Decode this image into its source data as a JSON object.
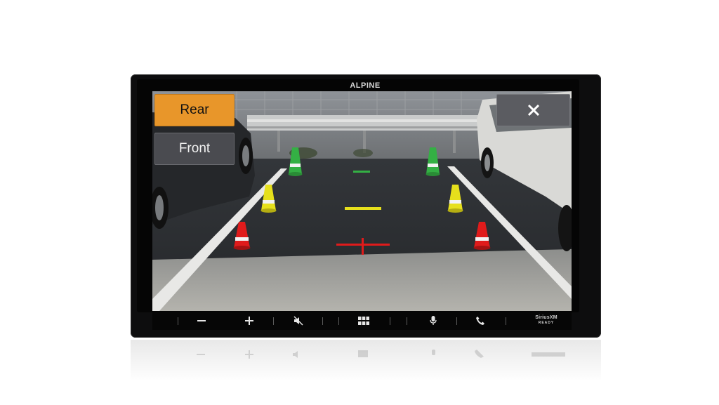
{
  "device": {
    "brand": "ALPINE"
  },
  "camera": {
    "rear_label": "Rear",
    "front_label": "Front",
    "close_label": "✕",
    "active_view": "Rear"
  },
  "controls": [
    {
      "name": "volume-down",
      "icon": "minus-icon"
    },
    {
      "name": "volume-up",
      "icon": "plus-icon"
    },
    {
      "name": "mute",
      "icon": "mute-icon"
    },
    {
      "name": "menu",
      "icon": "grid-icon"
    },
    {
      "name": "voice",
      "icon": "microphone-icon"
    },
    {
      "name": "phone",
      "icon": "phone-icon"
    }
  ],
  "siriusxm": {
    "label": "SiriusXM",
    "sublabel": "READY"
  },
  "colors": {
    "active_button": "#e8962a",
    "inactive_button": "#4a4b50",
    "guide_near": "#e01b1b",
    "guide_mid": "#e6e01c",
    "guide_far": "#34b044"
  }
}
